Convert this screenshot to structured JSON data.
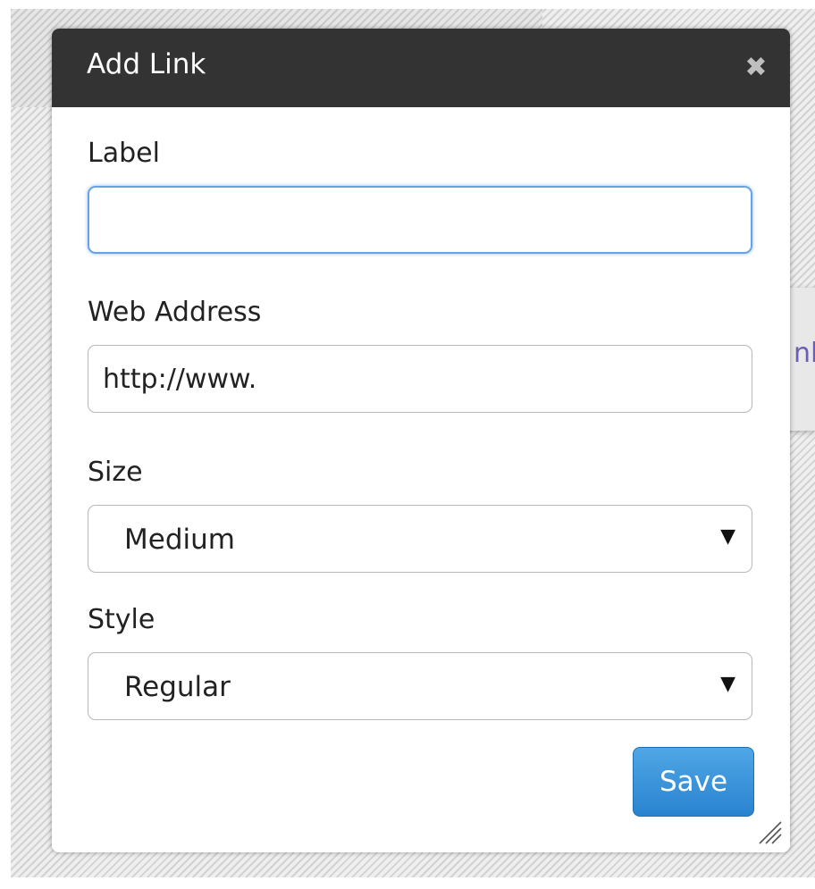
{
  "dialog": {
    "title": "Add Link",
    "close_icon": "close-icon",
    "label_field": {
      "label": "Label",
      "value": "",
      "placeholder": ""
    },
    "web_address_field": {
      "label": "Web Address",
      "value": "http://www."
    },
    "size_field": {
      "label": "Size",
      "selected": "Medium",
      "caret": "▼"
    },
    "style_field": {
      "label": "Style",
      "selected": "Regular",
      "caret": "▼"
    },
    "save_label": "Save",
    "resize_icon": "resize-handle-icon"
  },
  "background": {
    "partial_text": "nl"
  },
  "colors": {
    "titlebar": "#333333",
    "save_button": "#2a83cf",
    "focus_ring": "#66a3e6"
  }
}
